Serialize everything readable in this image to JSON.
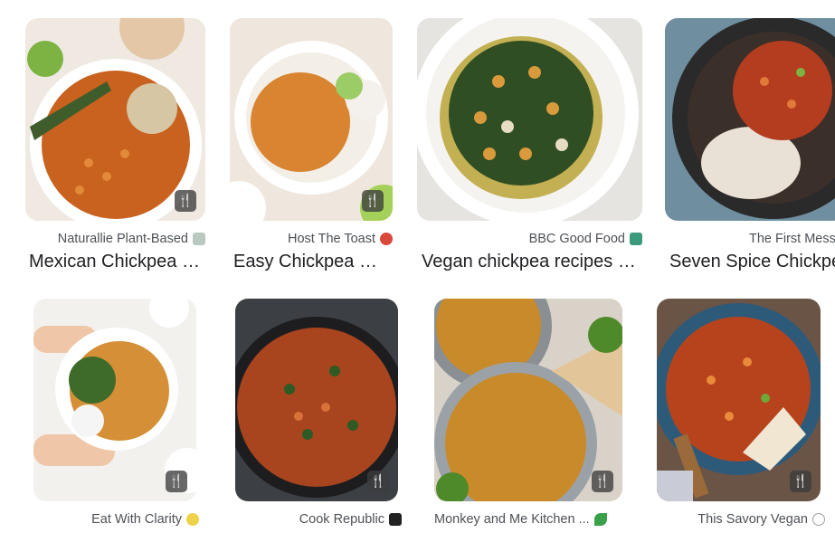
{
  "badge_icon": "fork-knife-icon",
  "badge_glyph": "🍴",
  "row1": [
    {
      "source": "Naturallie Plant-Based",
      "favicon": "square-gray-icon",
      "favicon_color": "#b9c9c0",
      "title": "Mexican Chickpea Curry"
    },
    {
      "source": "Host The Toast",
      "favicon": "toast-icon",
      "favicon_color": "#d9483b",
      "title": "Easy Chickpea Curry"
    },
    {
      "source": "BBC Good Food",
      "favicon": "bbc-gf-icon",
      "favicon_color": "#3b9a7b",
      "title": "Vegan chickpea recipes | BBC Good Food"
    },
    {
      "source": "The First Mess",
      "favicon": "",
      "favicon_color": "",
      "title": "Seven Spice Chickpea Stew"
    }
  ],
  "row2": [
    {
      "source": "Eat With Clarity",
      "favicon": "lemon-icon",
      "favicon_color": "#f0d24a"
    },
    {
      "source": "Cook Republic",
      "favicon": "cr-icon",
      "favicon_color": "#222222"
    },
    {
      "source": "Monkey and Me Kitchen ...",
      "favicon": "leaf-icon",
      "favicon_color": "#3aa04a"
    },
    {
      "source": "This Savory Vegan",
      "favicon": "info-icon",
      "favicon_color": "#9aa0a6"
    }
  ]
}
